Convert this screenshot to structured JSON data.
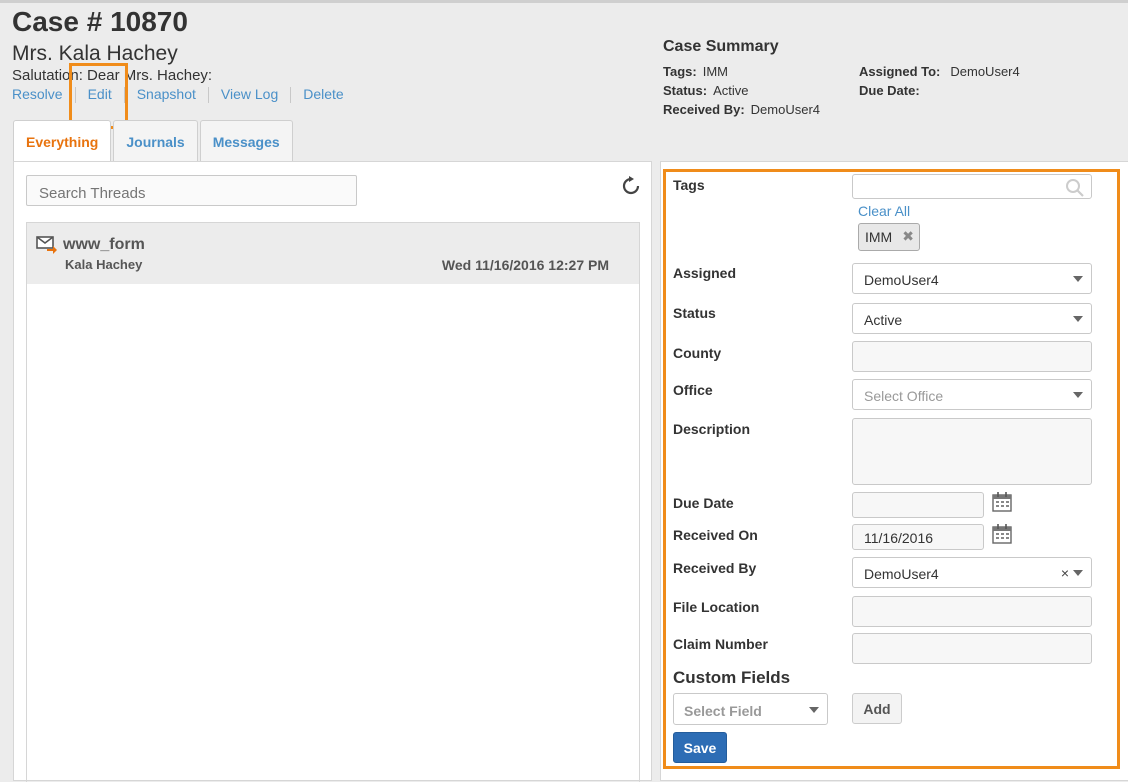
{
  "case": {
    "title": "Case # 10870",
    "name": "Mrs. Kala Hachey",
    "salutation": "Salutation: Dear Mrs. Hachey:"
  },
  "actions": [
    "Resolve",
    "Edit",
    "Snapshot",
    "View Log",
    "Delete"
  ],
  "summary": {
    "title": "Case Summary",
    "tags_label": "Tags:",
    "tags_value": "IMM",
    "status_label": "Status:",
    "status_value": "Active",
    "received_by_label": "Received By:",
    "received_by_value": "DemoUser4",
    "assigned_to_label": "Assigned To:",
    "assigned_to_value": "DemoUser4",
    "due_date_label": "Due Date:"
  },
  "tabs": [
    "Everything",
    "Journals",
    "Messages"
  ],
  "threads": {
    "search_placeholder": "Search Threads",
    "items": [
      {
        "subject": "www_form",
        "from": "Kala Hachey",
        "date": "Wed 11/16/2016 12:27 PM"
      }
    ]
  },
  "form": {
    "tags_label": "Tags",
    "clear_all": "Clear All",
    "tag_chip": "IMM",
    "assigned_label": "Assigned",
    "assigned_value": "DemoUser4",
    "status_label": "Status",
    "status_value": "Active",
    "county_label": "County",
    "office_label": "Office",
    "office_placeholder": "Select Office",
    "description_label": "Description",
    "due_date_label": "Due Date",
    "received_on_label": "Received On",
    "received_on_value": "11/16/2016",
    "received_by_label": "Received By",
    "received_by_value": "DemoUser4",
    "file_location_label": "File Location",
    "claim_number_label": "Claim Number",
    "custom_fields_title": "Custom Fields",
    "select_field_placeholder": "Select Field",
    "add_label": "Add",
    "save_label": "Save"
  },
  "colors": {
    "accent_orange": "#f08c1a",
    "link_blue": "#4a90c8",
    "save_blue": "#2d6db5"
  },
  "icons": [
    "refresh-icon",
    "mail-forward-icon",
    "search-icon",
    "calendar-icon",
    "remove-icon",
    "chevron-down-icon"
  ]
}
